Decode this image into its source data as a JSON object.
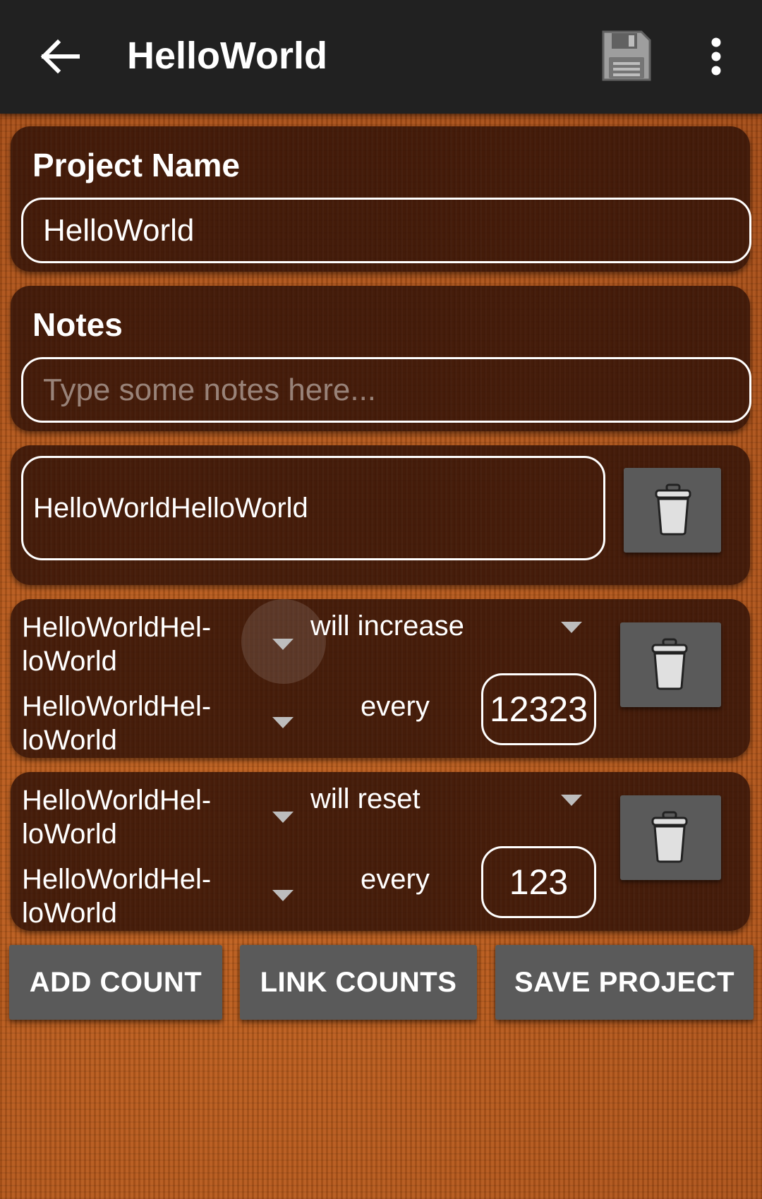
{
  "app_bar": {
    "title": "HelloWorld",
    "back_icon": "arrow-left-icon",
    "save_icon": "floppy-disk-icon",
    "more_icon": "more-vertical-icon"
  },
  "project_name": {
    "label": "Project Name",
    "value": "HelloWorld"
  },
  "notes": {
    "label": "Notes",
    "value": "",
    "placeholder": "Type some notes here..."
  },
  "counter": {
    "name": "HelloWorldHelloWorld"
  },
  "link_rules": [
    {
      "source": "HelloWorldHel-\nloWorld",
      "action": "will increase",
      "target": "HelloWorldHel-\nloWorld",
      "every_label": "every",
      "amount": "12323"
    },
    {
      "source": "HelloWorldHel-\nloWorld",
      "action": "will reset",
      "target": "HelloWorldHel-\nloWorld",
      "every_label": "every",
      "amount": "123"
    }
  ],
  "buttons": {
    "add_count": "ADD COUNT",
    "link_counts": "LINK COUNTS",
    "save_project": "SAVE PROJECT"
  },
  "colors": {
    "app_bar": "#212121",
    "card": "#3a1708",
    "button": "#5a5a5a",
    "background": "#b5571f"
  }
}
